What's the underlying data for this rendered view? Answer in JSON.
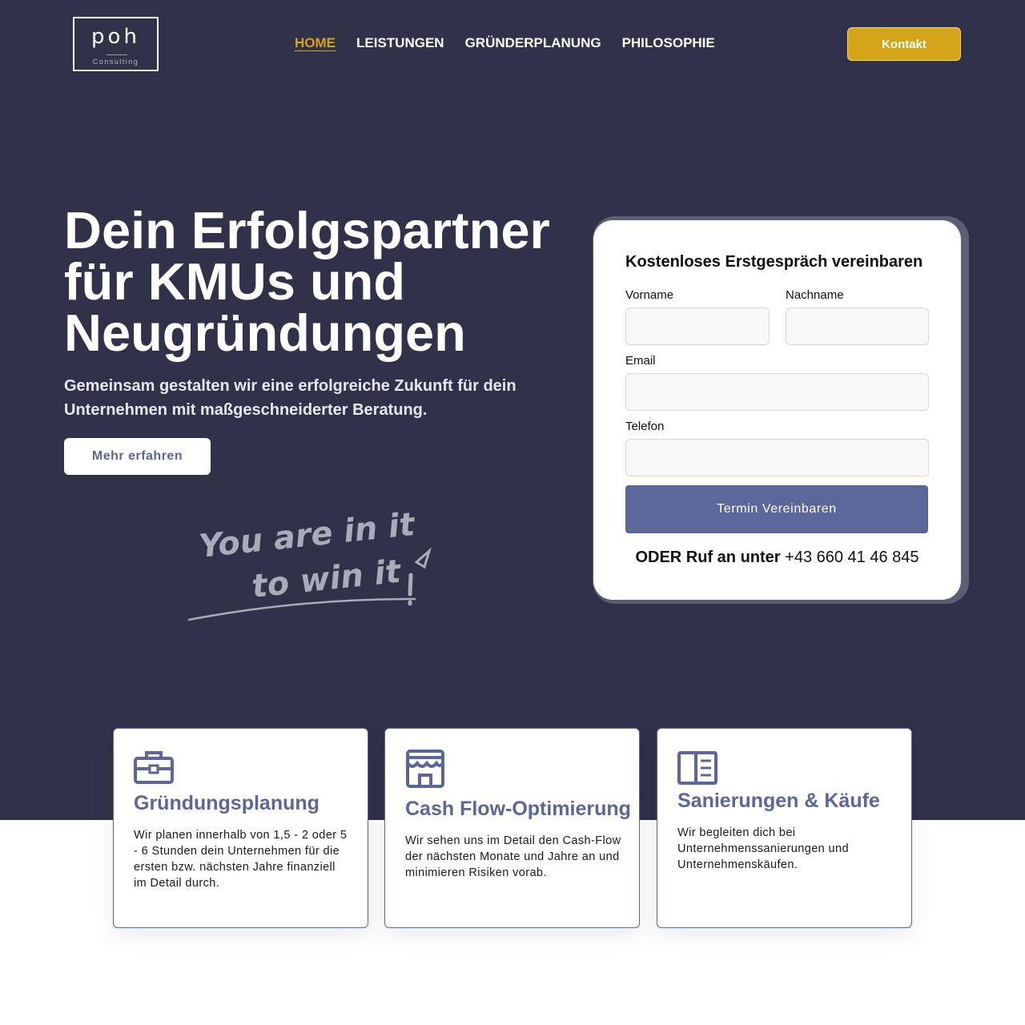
{
  "brand": {
    "logo_text": "poh",
    "logo_sub": "Consulting"
  },
  "nav": {
    "items": [
      {
        "label": "HOME",
        "active": true
      },
      {
        "label": "LEISTUNGEN",
        "active": false
      },
      {
        "label": "GRÜNDERPLANUNG",
        "active": false
      },
      {
        "label": "PHILOSOPHIE",
        "active": false
      }
    ],
    "cta_label": "Kontakt"
  },
  "hero": {
    "title_lines": [
      "Dein Erfolgspartner",
      "für KMUs und",
      "Neugründungen"
    ],
    "subtitle": "Gemeinsam gestalten wir eine erfolgreiche Zukunft für dein Unternehmen mit maßgeschneiderter Beratung.",
    "button_label": "Mehr erfahren",
    "handwriting_lines": [
      "You are in it",
      "to win it"
    ]
  },
  "form": {
    "title": "Kostenloses Erstgespräch vereinbaren",
    "fields": {
      "vorname": {
        "label": "Vorname",
        "value": ""
      },
      "nachname": {
        "label": "Nachname",
        "value": ""
      },
      "email": {
        "label": "Email",
        "value": ""
      },
      "telefon": {
        "label": "Telefon",
        "value": ""
      }
    },
    "submit_label": "Termin Vereinbaren",
    "call_prefix": "ODER Ruf an unter",
    "phone": "+43 660 41 46 845"
  },
  "services": [
    {
      "icon": "briefcase-icon",
      "title": "Gründungsplanung",
      "text": "Wir planen innerhalb von 1,5 - 2 oder 5 - 6 Stunden dein Unternehmen für die ersten bzw. nächsten Jahre finanziell im Detail durch."
    },
    {
      "icon": "storefront-icon",
      "title": "Cash Flow-Optimierung",
      "text": "Wir sehen uns im Detail den Cash-Flow der nächsten Monate und Jahre an und minimieren Risiken vorab."
    },
    {
      "icon": "book-icon",
      "title": "Sanierungen & Käufe",
      "text": "Wir begleiten dich bei Unternehmenssanierungen und Unternehmenskäufen."
    }
  ],
  "colors": {
    "hero_bg": "#2f3249",
    "accent_gold": "#d4a419",
    "accent_blue": "#5b6799"
  }
}
